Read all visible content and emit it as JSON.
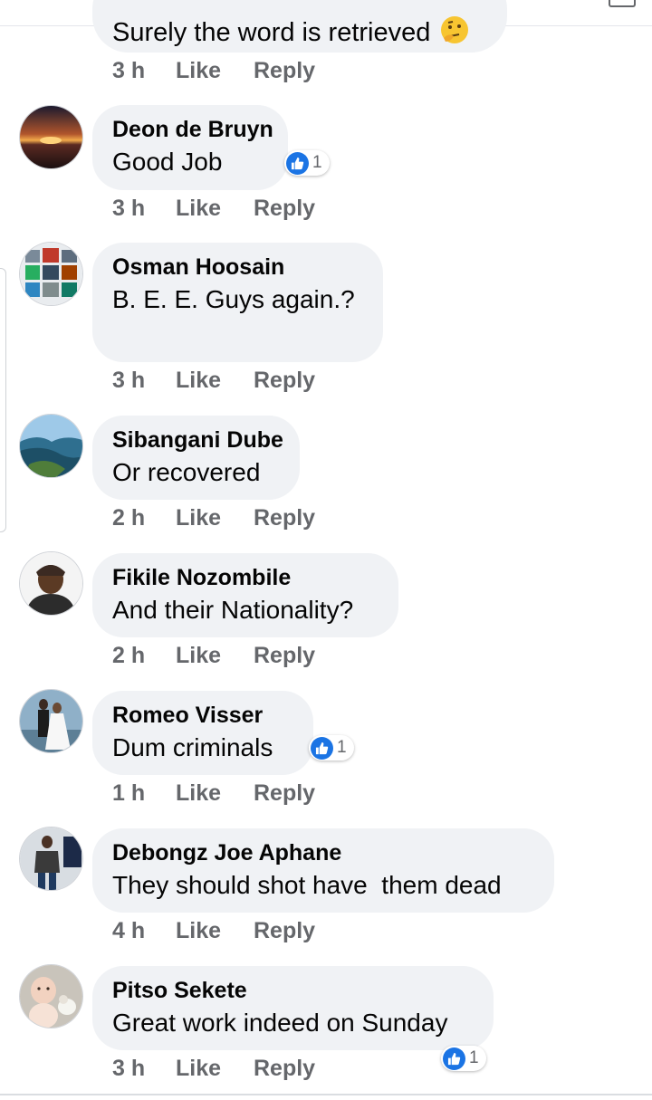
{
  "comments": [
    {
      "author": "",
      "text": "Surely the word is retrieved",
      "time": "3 h",
      "like": "Like",
      "reply": "Reply",
      "emoji": "thinking-face-emoji"
    },
    {
      "author": "Deon de Bruyn",
      "text": "Good Job",
      "time": "3 h",
      "like": "Like",
      "reply": "Reply",
      "reactions": {
        "icon": "thumbs-up-icon",
        "count": "1"
      },
      "avatar": "sunset-avatar"
    },
    {
      "author": "Osman Hoosain",
      "text": "B. E. E. Guys again.?",
      "time": "3 h",
      "like": "Like",
      "reply": "Reply",
      "avatar": "photo-collage-avatar"
    },
    {
      "author": "Sibangani Dube",
      "text": "Or recovered",
      "time": "2 h",
      "like": "Like",
      "reply": "Reply",
      "avatar": "landscape-avatar"
    },
    {
      "author": "Fikile Nozombile",
      "text": "And their Nationality?",
      "time": "2 h",
      "like": "Like",
      "reply": "Reply",
      "avatar": "person-cap-avatar"
    },
    {
      "author": "Romeo Visser",
      "text": "Dum criminals",
      "time": "1 h",
      "like": "Like",
      "reply": "Reply",
      "reactions": {
        "icon": "thumbs-up-icon",
        "count": "1"
      },
      "avatar": "wedding-couple-avatar"
    },
    {
      "author": "Debongz Joe Aphane",
      "text": "They should shot have  them dead",
      "time": "4 h",
      "like": "Like",
      "reply": "Reply",
      "avatar": "standing-person-avatar"
    },
    {
      "author": "Pitso Sekete",
      "text": "Great work indeed on Sunday",
      "time": "3 h",
      "like": "Like",
      "reply": "Reply",
      "reactions": {
        "icon": "thumbs-up-icon",
        "count": "1"
      },
      "avatar": "baby-dog-avatar"
    }
  ],
  "colors": {
    "bubble": "#f0f2f5",
    "meta": "#65676b",
    "like_blue": "#1b74e4",
    "text": "#050505"
  }
}
